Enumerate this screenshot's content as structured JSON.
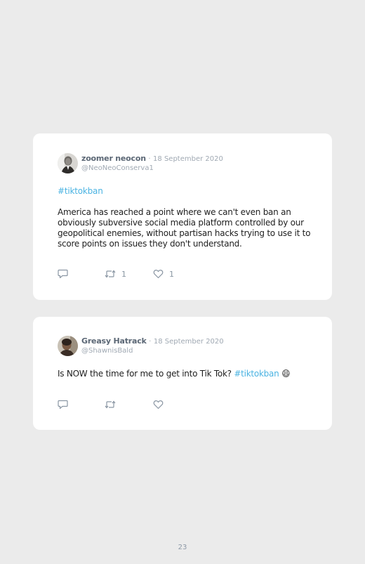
{
  "tweets": [
    {
      "name": "zoomer neocon",
      "separator": "·",
      "date": "18 September 2020",
      "handle": "@NeoNeoConserva1",
      "hashtag": "#tiktokban",
      "text": "America has reached a point where we can't even ban an obviously subversive social media platform controlled by our geopolitical enemies, without partisan hacks trying to use it to score points on issues they don't understand.",
      "retweets": "1",
      "likes": "1"
    },
    {
      "name": "Greasy Hatrack",
      "separator": "·",
      "date": "18 September 2020",
      "handle": "@ShawnisBald",
      "text": "Is NOW the time for me to get into Tik Tok?",
      "hashtag": "#tiktokban",
      "emoji": "😄",
      "retweets": "",
      "likes": ""
    }
  ],
  "icons": {
    "reply": "reply-icon",
    "retweet": "retweet-icon",
    "like": "heart-icon"
  },
  "colors": {
    "page_background": "#ebebeb",
    "card_background": "#ffffff",
    "hashtag": "#4ab3e2",
    "icon": "#8a96a3"
  },
  "page_number": "23"
}
